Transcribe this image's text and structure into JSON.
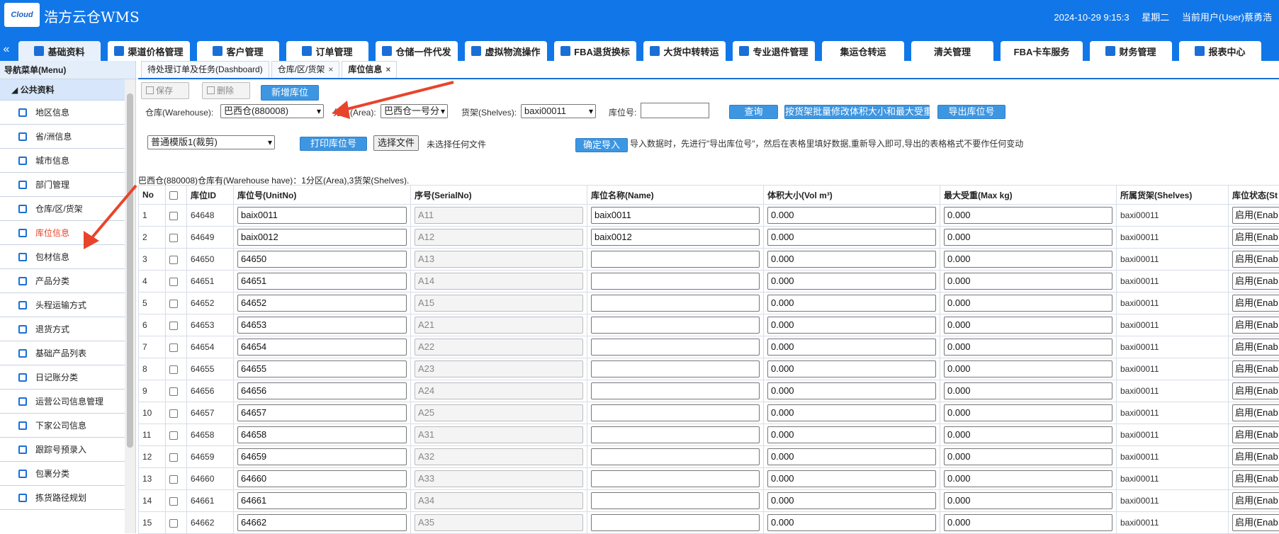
{
  "header": {
    "logo_text": "Cloud",
    "app_title": "浩方云仓WMS",
    "datetime": "2024-10-29 9:15:3",
    "weekday": "星期二",
    "user": "当前用户(User)蔡勇浩"
  },
  "nav": {
    "left_arrow": "«",
    "tabs": [
      {
        "label": "基础资料",
        "icon": "tag-icon"
      },
      {
        "label": "渠道价格管理",
        "icon": "price-icon"
      },
      {
        "label": "客户管理",
        "icon": "user-icon"
      },
      {
        "label": "订单管理",
        "icon": "list-icon"
      },
      {
        "label": "仓储一件代发",
        "icon": "truck-icon"
      },
      {
        "label": "虚拟物流操作",
        "icon": "server-icon"
      },
      {
        "label": "FBA退货换标",
        "icon": "label-icon"
      },
      {
        "label": "大货中转转运",
        "icon": "ship-icon"
      },
      {
        "label": "专业退件管理",
        "icon": "return-icon"
      },
      {
        "label": "集运仓转运",
        "icon": ""
      },
      {
        "label": "清关管理",
        "icon": ""
      },
      {
        "label": "FBA卡车服务",
        "icon": ""
      },
      {
        "label": "财务管理",
        "icon": "finance-icon"
      },
      {
        "label": "报表中心",
        "icon": "database-icon"
      }
    ]
  },
  "sidebar": {
    "title": "导航菜单(Menu)",
    "group": "公共资料",
    "items": [
      {
        "label": "地区信息",
        "icon": "edit-icon"
      },
      {
        "label": "省/洲信息",
        "icon": "edit-icon"
      },
      {
        "label": "城市信息",
        "icon": "edit-icon"
      },
      {
        "label": "部门管理",
        "icon": "user-icon"
      },
      {
        "label": "仓库/区/货架",
        "icon": "shelf-icon"
      },
      {
        "label": "库位信息",
        "icon": "grid-icon",
        "active": true
      },
      {
        "label": "包材信息",
        "icon": "edit-icon"
      },
      {
        "label": "产品分类",
        "icon": "compass-icon"
      },
      {
        "label": "头程运输方式",
        "icon": "compass-icon"
      },
      {
        "label": "退货方式",
        "icon": "edit-icon"
      },
      {
        "label": "基础产品列表",
        "icon": "edit-icon"
      },
      {
        "label": "日记账分类",
        "icon": "edit-icon"
      },
      {
        "label": "运营公司信息管理",
        "icon": "edit-icon"
      },
      {
        "label": "下家公司信息",
        "icon": "edit-icon"
      },
      {
        "label": "跟踪号预录入",
        "icon": "edit-icon"
      },
      {
        "label": "包裹分类",
        "icon": "edit-icon"
      },
      {
        "label": "拣货路径规划",
        "icon": "edit-icon"
      }
    ]
  },
  "tabs": [
    {
      "label": "待处理订单及任务(Dashboard)",
      "closable": false
    },
    {
      "label": "仓库/区/货架",
      "closable": true
    },
    {
      "label": "库位信息",
      "closable": true,
      "active": true
    }
  ],
  "toolbar": {
    "save_label": "保存",
    "delete_label": "删除",
    "add_label": "新增库位"
  },
  "filters": {
    "warehouse_label": "仓库(Warehouse):",
    "warehouse_value": "巴西仓(880008)",
    "area_label": "分区(Area):",
    "area_value": "巴西仓一号分",
    "shelves_label": "货架(Shelves):",
    "shelves_value": "baxi00011",
    "unit_label": "库位号:",
    "unit_value": "",
    "query_label": "查询",
    "batch_label": "按货架批量修改体积大小和最大受重",
    "export_label": "导出库位号",
    "template_value": "普通模版1(裁剪)",
    "print_label": "打印库位号",
    "choose_file_label": "选择文件",
    "no_file_text": "未选择任何文件",
    "import_label": "确定导入",
    "import_note": "导入数据时，先进行\"导出库位号\"，然后在表格里填好数据,重新导入即可,导出的表格格式不要作任何变动"
  },
  "summary": "巴西仓(880008)仓库有(Warehouse have)：1分区(Area),3货架(Shelves).",
  "table": {
    "headers": [
      "No",
      "",
      "库位ID",
      "库位号(UnitNo)",
      "序号(SerialNo)",
      "库位名称(Name)",
      "体积大小(Vol m³)",
      "最大受重(Max kg)",
      "所属货架(Shelves)",
      "库位状态(St"
    ],
    "rows": [
      {
        "no": "1",
        "id": "64648",
        "unit": "baix0011",
        "serial": "A11",
        "name": "baix0011",
        "vol": "0.000",
        "kg": "0.000",
        "shelf": "baxi00011",
        "status": "启用(Enab"
      },
      {
        "no": "2",
        "id": "64649",
        "unit": "baix0012",
        "serial": "A12",
        "name": "baix0012",
        "vol": "0.000",
        "kg": "0.000",
        "shelf": "baxi00011",
        "status": "启用(Enab"
      },
      {
        "no": "3",
        "id": "64650",
        "unit": "64650",
        "serial": "A13",
        "name": "",
        "vol": "0.000",
        "kg": "0.000",
        "shelf": "baxi00011",
        "status": "启用(Enab"
      },
      {
        "no": "4",
        "id": "64651",
        "unit": "64651",
        "serial": "A14",
        "name": "",
        "vol": "0.000",
        "kg": "0.000",
        "shelf": "baxi00011",
        "status": "启用(Enab"
      },
      {
        "no": "5",
        "id": "64652",
        "unit": "64652",
        "serial": "A15",
        "name": "",
        "vol": "0.000",
        "kg": "0.000",
        "shelf": "baxi00011",
        "status": "启用(Enab"
      },
      {
        "no": "6",
        "id": "64653",
        "unit": "64653",
        "serial": "A21",
        "name": "",
        "vol": "0.000",
        "kg": "0.000",
        "shelf": "baxi00011",
        "status": "启用(Enab"
      },
      {
        "no": "7",
        "id": "64654",
        "unit": "64654",
        "serial": "A22",
        "name": "",
        "vol": "0.000",
        "kg": "0.000",
        "shelf": "baxi00011",
        "status": "启用(Enab"
      },
      {
        "no": "8",
        "id": "64655",
        "unit": "64655",
        "serial": "A23",
        "name": "",
        "vol": "0.000",
        "kg": "0.000",
        "shelf": "baxi00011",
        "status": "启用(Enab"
      },
      {
        "no": "9",
        "id": "64656",
        "unit": "64656",
        "serial": "A24",
        "name": "",
        "vol": "0.000",
        "kg": "0.000",
        "shelf": "baxi00011",
        "status": "启用(Enab"
      },
      {
        "no": "10",
        "id": "64657",
        "unit": "64657",
        "serial": "A25",
        "name": "",
        "vol": "0.000",
        "kg": "0.000",
        "shelf": "baxi00011",
        "status": "启用(Enab"
      },
      {
        "no": "11",
        "id": "64658",
        "unit": "64658",
        "serial": "A31",
        "name": "",
        "vol": "0.000",
        "kg": "0.000",
        "shelf": "baxi00011",
        "status": "启用(Enab"
      },
      {
        "no": "12",
        "id": "64659",
        "unit": "64659",
        "serial": "A32",
        "name": "",
        "vol": "0.000",
        "kg": "0.000",
        "shelf": "baxi00011",
        "status": "启用(Enab"
      },
      {
        "no": "13",
        "id": "64660",
        "unit": "64660",
        "serial": "A33",
        "name": "",
        "vol": "0.000",
        "kg": "0.000",
        "shelf": "baxi00011",
        "status": "启用(Enab"
      },
      {
        "no": "14",
        "id": "64661",
        "unit": "64661",
        "serial": "A34",
        "name": "",
        "vol": "0.000",
        "kg": "0.000",
        "shelf": "baxi00011",
        "status": "启用(Enab"
      },
      {
        "no": "15",
        "id": "64662",
        "unit": "64662",
        "serial": "A35",
        "name": "",
        "vol": "0.000",
        "kg": "0.000",
        "shelf": "baxi00011",
        "status": "启用(Enab"
      }
    ]
  },
  "colors": {
    "brand_blue": "#1177e8",
    "button_blue": "#3d96e2",
    "annotation_red": "#e8442b"
  }
}
